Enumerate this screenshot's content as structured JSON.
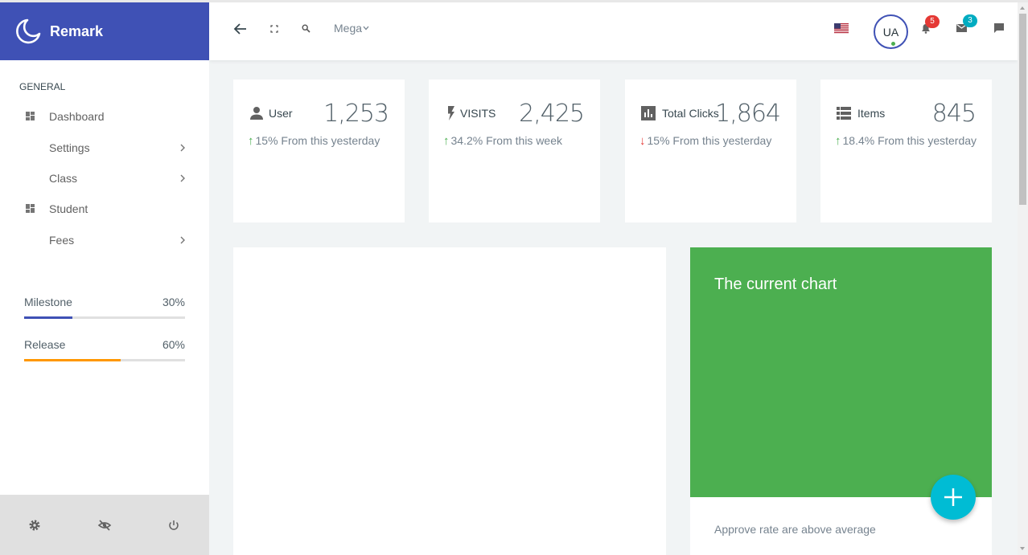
{
  "brand": {
    "name": "Remark"
  },
  "sidebar": {
    "section_title": "GENERAL",
    "items": [
      {
        "label": "Dashboard",
        "icon": "dashboard-icon",
        "has_submenu": false
      },
      {
        "label": "Settings",
        "icon": null,
        "has_submenu": true
      },
      {
        "label": "Class",
        "icon": null,
        "has_submenu": true
      },
      {
        "label": "Student",
        "icon": "dashboard-icon",
        "has_submenu": false
      },
      {
        "label": "Fees",
        "icon": null,
        "has_submenu": true
      }
    ],
    "progress": [
      {
        "label": "Milestone",
        "value": "30%",
        "fraction": 0.3,
        "color": "#3f51b5"
      },
      {
        "label": "Release",
        "value": "60%",
        "fraction": 0.6,
        "color": "#ff9800"
      }
    ],
    "footer_icons": [
      "settings-icon",
      "hide-icon",
      "power-icon"
    ]
  },
  "header": {
    "mega_label": "Mega",
    "avatar_initials": "UA",
    "notifications_count": "5",
    "messages_count": "3",
    "badge_colors": {
      "notifications": "#e53935",
      "messages": "#00acc1"
    }
  },
  "stats": [
    {
      "icon": "user-icon",
      "label": "User",
      "value": "1,253",
      "trend": "up",
      "change": "15% From this yesterday"
    },
    {
      "icon": "flash-icon",
      "label": "VISITS",
      "value": "2,425",
      "trend": "up",
      "change": "34.2% From this week"
    },
    {
      "icon": "bar-chart-icon",
      "label": "Total Clicks",
      "value": "1,864",
      "trend": "down",
      "change": "15% From this yesterday"
    },
    {
      "icon": "list-icon",
      "label": "Items",
      "value": "845",
      "trend": "up",
      "change": "18.4% From this yesterday"
    }
  ],
  "chart_panel": {
    "title": "The current chart",
    "footer_text": "Approve rate are above average",
    "color": "#4caf50"
  },
  "colors": {
    "primary": "#3f51b5",
    "up": "#4caf50",
    "down": "#e53935",
    "fab": "#00bcd4"
  }
}
